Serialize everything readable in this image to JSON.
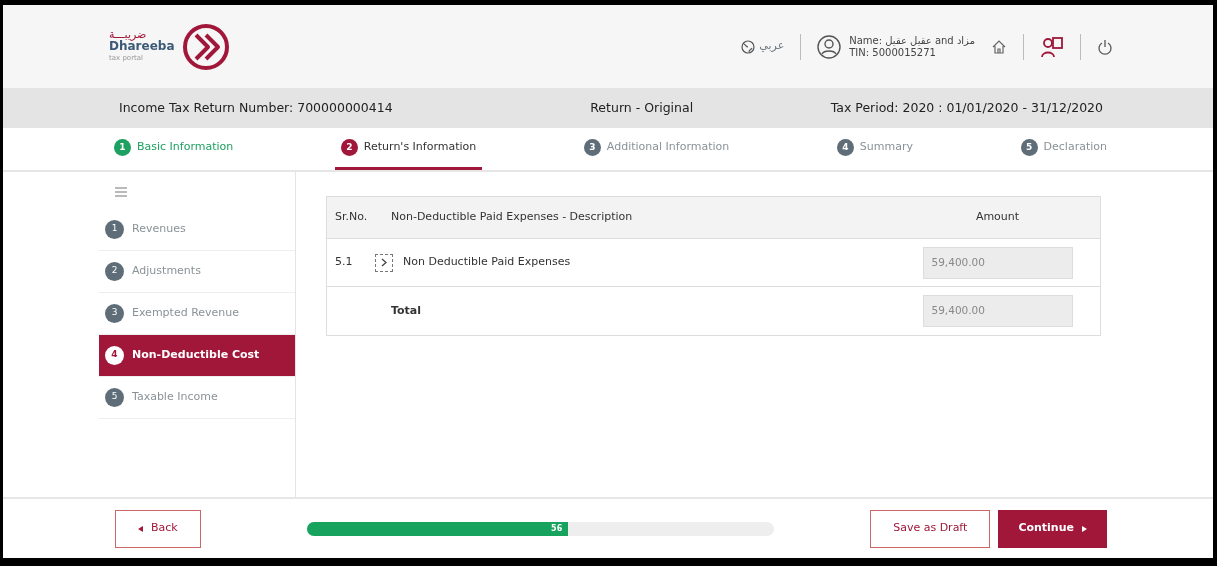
{
  "header": {
    "logo": {
      "arabic": "ضريبـــة",
      "name": "Dhareeba",
      "tagline": "tax portal"
    },
    "language": "عربي",
    "user": {
      "name": "Name: عقيل عقيل and مزاد",
      "tin": "TIN: 5000015271"
    }
  },
  "info_bar": {
    "return_number": "Income Tax Return Number: 700000000414",
    "return_type": "Return - Original",
    "tax_period": "Tax Period: 2020 : 01/01/2020 - 31/12/2020"
  },
  "steps": [
    {
      "number": "1",
      "label": "Basic Information",
      "completed": true,
      "selected": false
    },
    {
      "number": "2",
      "label": "Return's Information",
      "completed": false,
      "selected": true
    },
    {
      "number": "3",
      "label": "Additional Information",
      "completed": false,
      "selected": false
    },
    {
      "number": "4",
      "label": "Summary",
      "completed": false,
      "selected": false
    },
    {
      "number": "5",
      "label": "Declaration",
      "completed": false,
      "selected": false
    }
  ],
  "sidebar": {
    "items": [
      {
        "number": "1",
        "label": "Revenues",
        "selected": false
      },
      {
        "number": "2",
        "label": "Adjustments",
        "selected": false
      },
      {
        "number": "3",
        "label": "Exempted Revenue",
        "selected": false
      },
      {
        "number": "4",
        "label": "Non-Deductible Cost",
        "selected": true
      },
      {
        "number": "5",
        "label": "Taxable Income",
        "selected": false
      }
    ]
  },
  "table": {
    "columns": [
      "Sr.No.",
      "Non-Deductible Paid Expenses - Description",
      "Amount"
    ],
    "rows": [
      {
        "sr_no": "5.1",
        "description": "Non Deductible Paid Expenses",
        "amount": "59,400.00",
        "expandable": true
      }
    ],
    "total": {
      "label": "Total",
      "amount": "59,400.00"
    }
  },
  "footer": {
    "back": "Back",
    "progress": {
      "level": 0.56,
      "label": "56"
    },
    "save_draft": "Save as Draft",
    "continue": "Continue"
  }
}
